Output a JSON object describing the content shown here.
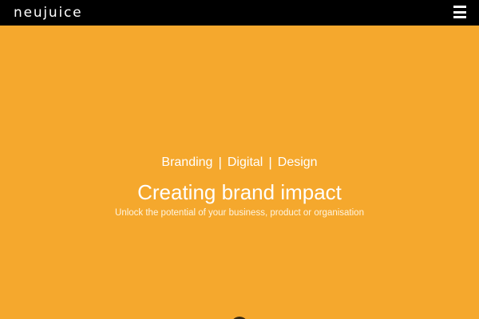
{
  "header": {
    "logo_text": "neujuice",
    "menu_icon": "hamburger-menu-icon"
  },
  "hero": {
    "services": [
      "Branding",
      "Digital",
      "Design"
    ],
    "separator": "|",
    "headline": "Creating brand impact",
    "tagline": "Unlock the potential of your business, product or organisation",
    "scroll_icon": "scroll-down-icon"
  },
  "colors": {
    "header_background": "#000000",
    "hero_background": "#f5a82d",
    "text": "#ffffff"
  }
}
